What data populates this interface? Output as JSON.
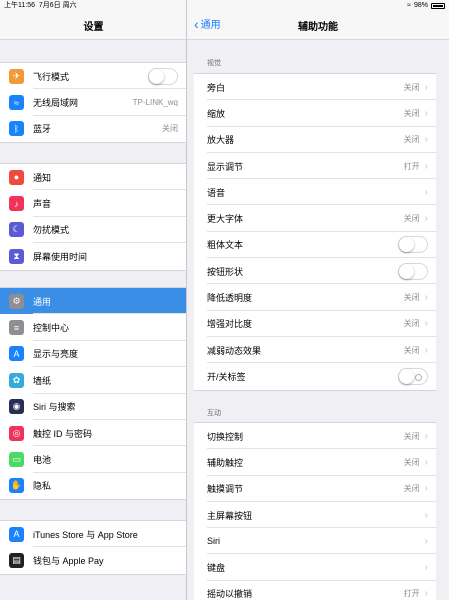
{
  "status": {
    "time": "上午11:56",
    "date": "7月6日 周六",
    "battery": "98%"
  },
  "left": {
    "title": "设置",
    "groups": [
      [
        {
          "label": "飞行模式",
          "icon": "airplane-icon",
          "color": "#f19a37",
          "glyph": "✈",
          "toggle": true
        },
        {
          "label": "无线局域网",
          "icon": "wifi-icon",
          "color": "#1a82fb",
          "glyph": "≈",
          "value": "TP-LINK_wq"
        },
        {
          "label": "蓝牙",
          "icon": "bluetooth-icon",
          "color": "#1a82fb",
          "glyph": "ᛒ",
          "value": "关闭"
        }
      ],
      [
        {
          "label": "通知",
          "icon": "notifications-icon",
          "color": "#f0493e",
          "glyph": "●"
        },
        {
          "label": "声音",
          "icon": "sound-icon",
          "color": "#f0335a",
          "glyph": "♪"
        },
        {
          "label": "勿扰模式",
          "icon": "do-not-disturb-icon",
          "color": "#5b5bd6",
          "glyph": "☾"
        },
        {
          "label": "屏幕使用时间",
          "icon": "screen-time-icon",
          "color": "#5b5bd6",
          "glyph": "⧗"
        }
      ],
      [
        {
          "label": "通用",
          "icon": "gear-icon",
          "color": "#8e8e93",
          "glyph": "⚙",
          "selected": true
        },
        {
          "label": "控制中心",
          "icon": "control-center-icon",
          "color": "#8e8e93",
          "glyph": "≡"
        },
        {
          "label": "显示与亮度",
          "icon": "display-icon",
          "color": "#1a82fb",
          "glyph": "A"
        },
        {
          "label": "墙纸",
          "icon": "wallpaper-icon",
          "color": "#35aadc",
          "glyph": "✿"
        },
        {
          "label": "Siri 与搜索",
          "icon": "siri-icon",
          "color": "#2c2c54",
          "glyph": "◉"
        },
        {
          "label": "触控 ID 与密码",
          "icon": "touch-id-icon",
          "color": "#f0335a",
          "glyph": "◎"
        },
        {
          "label": "电池",
          "icon": "battery-icon",
          "color": "#4cd964",
          "glyph": "▭"
        },
        {
          "label": "隐私",
          "icon": "privacy-hand-icon",
          "color": "#1a82fb",
          "glyph": "✋"
        }
      ],
      [
        {
          "label": "iTunes Store 与 App Store",
          "icon": "app-store-icon",
          "color": "#1a82fb",
          "glyph": "A"
        },
        {
          "label": "钱包与 Apple Pay",
          "icon": "wallet-icon",
          "color": "#222222",
          "glyph": "▤"
        }
      ]
    ]
  },
  "right": {
    "back": "通用",
    "title": "辅助功能",
    "sections": [
      {
        "header": "视觉",
        "rows": [
          {
            "label": "旁白",
            "value": "关闭",
            "chevron": true
          },
          {
            "label": "缩放",
            "value": "关闭",
            "chevron": true
          },
          {
            "label": "放大器",
            "value": "关闭",
            "chevron": true
          },
          {
            "label": "显示调节",
            "value": "打开",
            "chevron": true
          },
          {
            "label": "语音",
            "chevron": true
          },
          {
            "label": "更大字体",
            "value": "关闭",
            "chevron": true
          },
          {
            "label": "粗体文本",
            "toggle": true
          },
          {
            "label": "按钮形状",
            "toggle": true
          },
          {
            "label": "降低透明度",
            "value": "关闭",
            "chevron": true
          },
          {
            "label": "增强对比度",
            "value": "关闭",
            "chevron": true
          },
          {
            "label": "减弱动态效果",
            "value": "关闭",
            "chevron": true
          },
          {
            "label": "开/关标签",
            "toggle": true,
            "onoff": true
          }
        ]
      },
      {
        "header": "互动",
        "rows": [
          {
            "label": "切换控制",
            "value": "关闭",
            "chevron": true
          },
          {
            "label": "辅助触控",
            "value": "关闭",
            "chevron": true
          },
          {
            "label": "触摸调节",
            "value": "关闭",
            "chevron": true
          },
          {
            "label": "主屏幕按钮",
            "chevron": true
          },
          {
            "label": "Siri",
            "chevron": true
          },
          {
            "label": "键盘",
            "chevron": true
          },
          {
            "label": "摇动以撤销",
            "value": "打开",
            "chevron": true
          }
        ]
      }
    ]
  }
}
